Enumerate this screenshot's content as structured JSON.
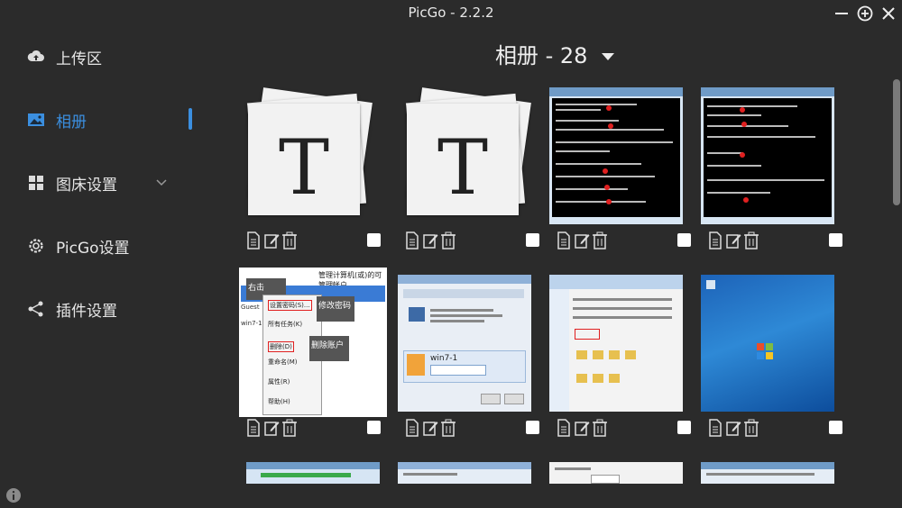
{
  "app": {
    "title": "PicGo - 2.2.2"
  },
  "sidebar": {
    "items": [
      {
        "label": "上传区",
        "icon": "cloud-upload-icon"
      },
      {
        "label": "相册",
        "icon": "image-icon"
      },
      {
        "label": "图床设置",
        "icon": "grid-icon"
      },
      {
        "label": "PicGo设置",
        "icon": "gear-icon"
      },
      {
        "label": "插件设置",
        "icon": "share-icon"
      }
    ],
    "active": "相册"
  },
  "album": {
    "title": "相册 - 28"
  },
  "grid": {
    "rows": [
      [
        "T sticker",
        "T sticker",
        "cmd net user",
        "cmd administrator"
      ],
      [
        "context menu 设置密码 删除账户",
        "win7-1 account dialog",
        "explorer window",
        "Windows 7 desktop"
      ],
      [
        "win7 screenshot",
        "win7 screenshot",
        "win7 dialog",
        "win7 explorer"
      ]
    ],
    "row1_overlay_texts": {
      "context_menu": [
        "右击",
        "设置密码(S)...",
        "修改密码",
        "所有任务(K)",
        "删除(D)",
        "删除账户",
        "重命名(M)",
        "属性(R)",
        "帮助(H)",
        "管理计算机(或)的可管理帐户",
        "win7-1",
        "Guest"
      ],
      "account_dialog": [
        "win7-1"
      ]
    }
  },
  "colors": {
    "accent": "#3b8fe0",
    "background": "#2b2b2b"
  }
}
